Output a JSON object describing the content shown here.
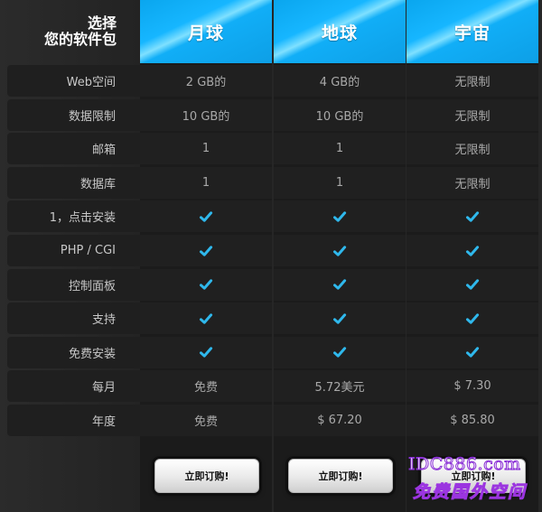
{
  "corner": {
    "line1": "选择",
    "line2": "您的软件包"
  },
  "plans": [
    {
      "name": "月球",
      "cells": [
        "2 GB的",
        "10 GB的",
        "1",
        "1",
        "check",
        "check",
        "check",
        "check",
        "check",
        "免费",
        "免费"
      ],
      "button": "立即订购!"
    },
    {
      "name": "地球",
      "cells": [
        "4 GB的",
        "10 GB的",
        "1",
        "1",
        "check",
        "check",
        "check",
        "check",
        "check",
        "5.72美元",
        "$ 67.20"
      ],
      "button": "立即订购!"
    },
    {
      "name": "宇宙",
      "cells": [
        "无限制",
        "无限制",
        "无限制",
        "无限制",
        "check",
        "check",
        "check",
        "check",
        "check",
        "$ 7.30",
        "$ 85.80"
      ],
      "button": "立即订购!"
    }
  ],
  "features": [
    "Web空间",
    "数据限制",
    "邮箱",
    "数据库",
    "1，点击安装",
    "PHP / CGI",
    "控制面板",
    "支持",
    "免费安装",
    "每月",
    "年度"
  ],
  "watermark": {
    "line1": "IDC886.com",
    "line2": "免费国外空间"
  },
  "colors": {
    "accent": "#12b0f8",
    "check": "#2fb8ec"
  }
}
